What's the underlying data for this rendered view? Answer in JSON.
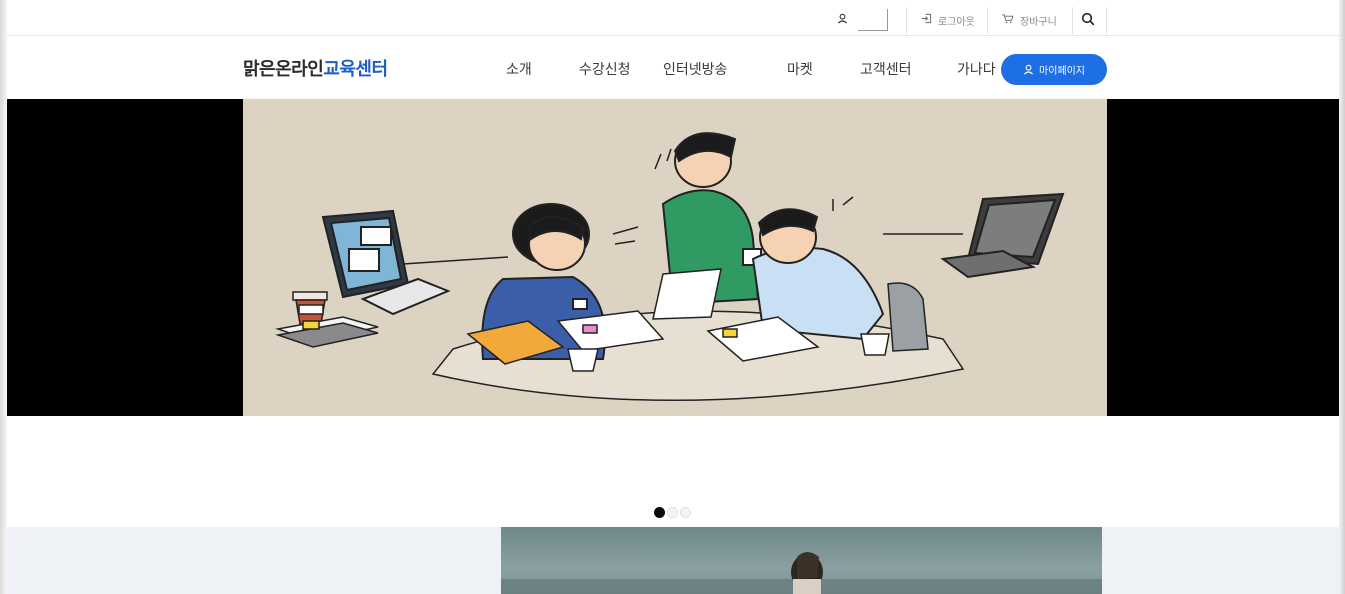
{
  "topbar": {
    "user_icon": "user-icon",
    "logout_label": "로그아웃",
    "logout_icon": "logout-icon",
    "cart_label": "장바구니",
    "cart_icon": "cart-icon",
    "search_icon": "search-icon"
  },
  "header": {
    "logo_part1": "맑은온라인",
    "logo_part2": "교육센터",
    "menu": [
      {
        "label": "소개"
      },
      {
        "label": "수강신청"
      },
      {
        "label": "인터넷방송"
      },
      {
        "label": "마켓"
      },
      {
        "label": "고객센터"
      },
      {
        "label": "가나다"
      }
    ],
    "mypage_label": "마이페이지",
    "brand_color": "#1e6ee6",
    "logo_accent": "#1f5fc4"
  },
  "slider": {
    "total_slides": 3,
    "active_index": 0
  }
}
